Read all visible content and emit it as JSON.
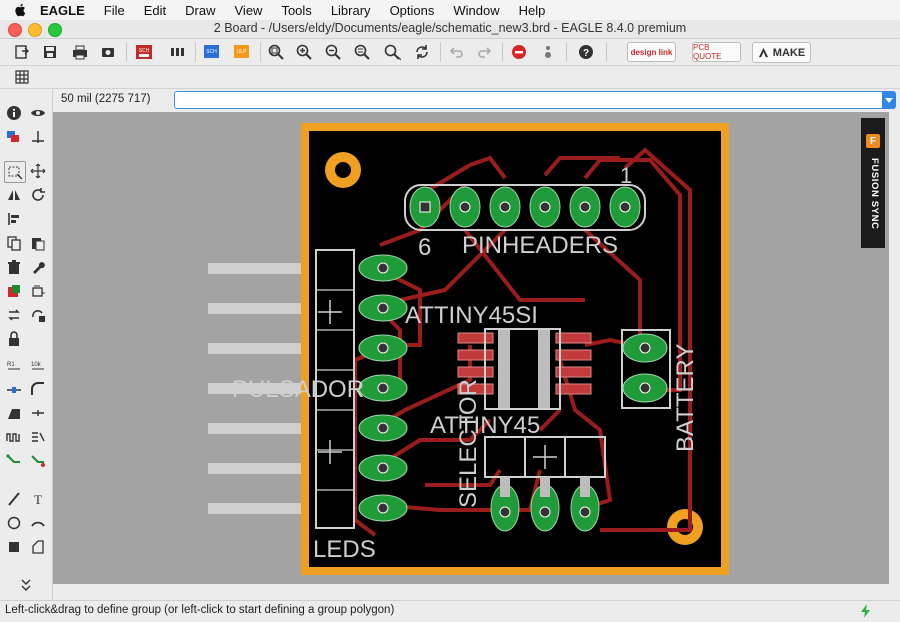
{
  "menubar": {
    "app": "EAGLE",
    "items": [
      "File",
      "Edit",
      "Draw",
      "View",
      "Tools",
      "Library",
      "Options",
      "Window",
      "Help"
    ]
  },
  "window": {
    "title": "2 Board - /Users/eldy/Documents/eagle/schematic_new3.brd - EAGLE 8.4.0 premium"
  },
  "toolbar": {
    "sch_label": "SCH",
    "ulp_label": "ULP",
    "designlink_label": "design link",
    "pcbquote_label": "PCB QUOTE",
    "make_label": "MAKE"
  },
  "command_bar": {
    "coordinates": "50 mil (2275 717)",
    "input_value": ""
  },
  "fusion_panel": {
    "label": "FUSION SYNC"
  },
  "board": {
    "labels": {
      "pinheaders": "PINHEADERS",
      "pin_six": "6",
      "pin_one": "1",
      "attiny45si": "ATTINY45SI",
      "attiny45": "ATTINY45",
      "pulsador": "PULSADOR",
      "selector": "SELECTOR",
      "battery": "BATTERY",
      "leds": "LEDS"
    },
    "colors": {
      "background": "#000000",
      "outline": "#f0a020",
      "copper": "#9b1c1c",
      "pads": "#1f9b3a",
      "silk": "#d0d0d0"
    }
  },
  "status": {
    "text": "Left-click&drag to define group (or left-click to start defining a group polygon)"
  }
}
